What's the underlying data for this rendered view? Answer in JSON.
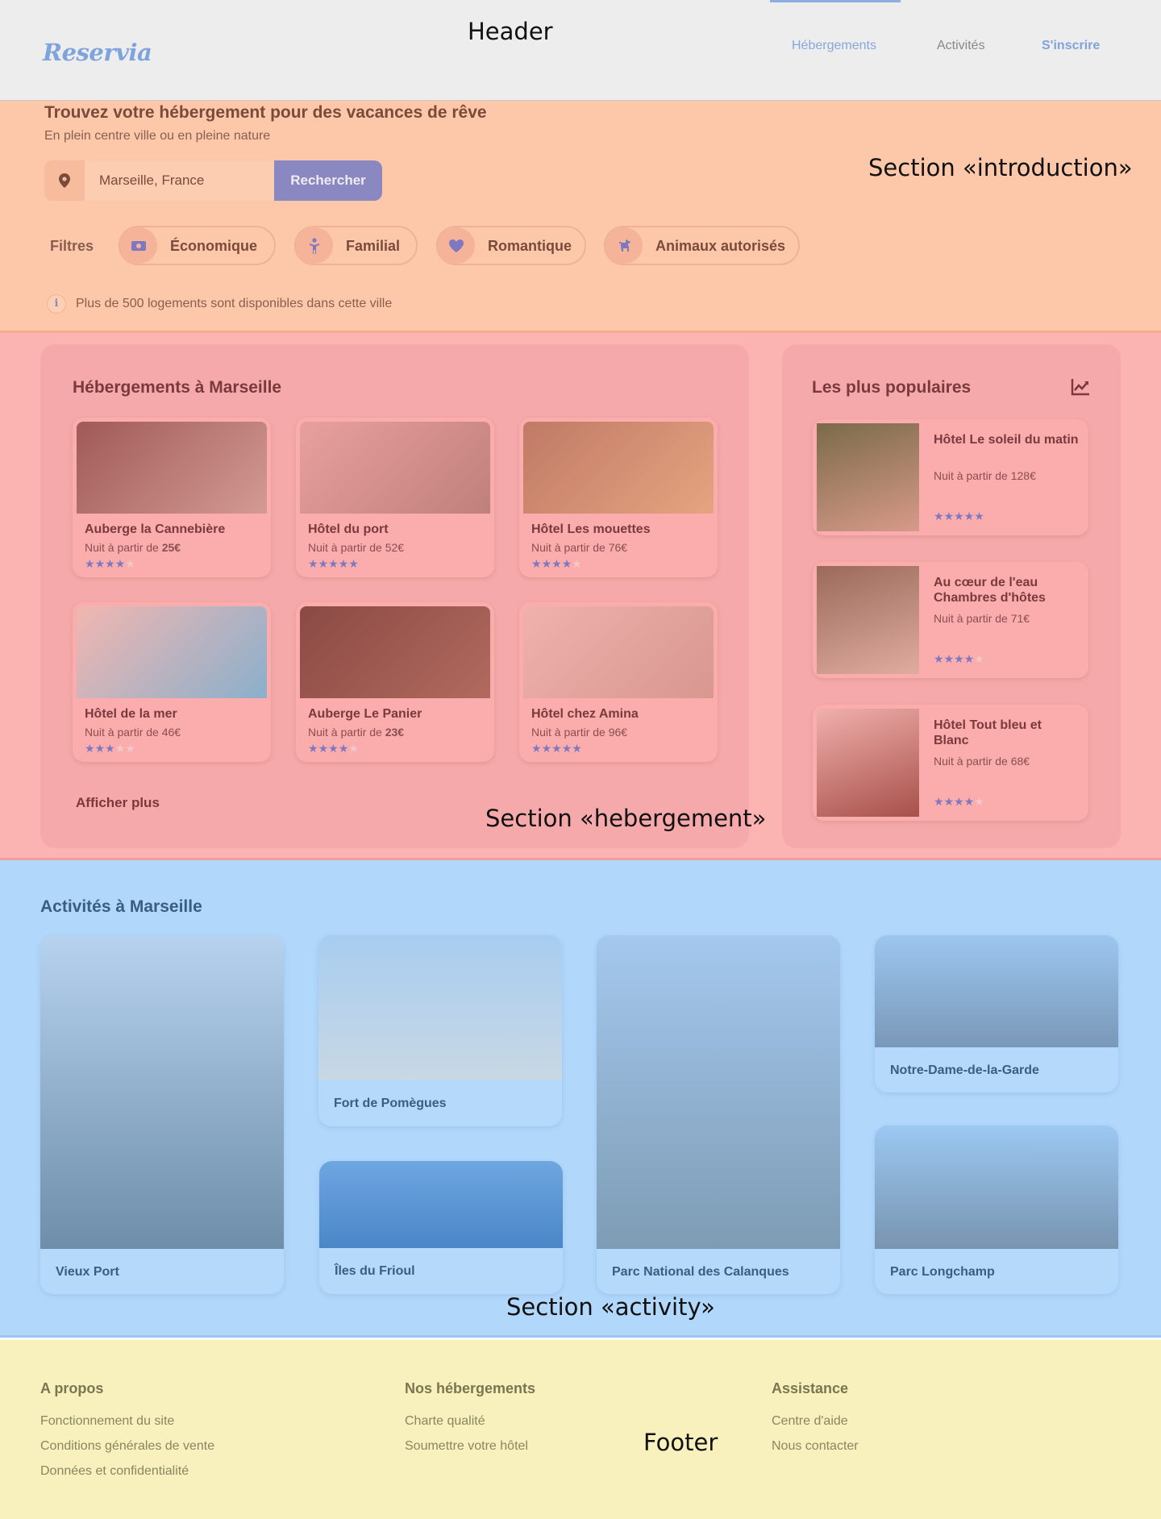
{
  "header": {
    "logo": "Reservia",
    "annotation": "Header",
    "nav": [
      {
        "label": "Hébergements",
        "active": true
      },
      {
        "label": "Activités",
        "active": false
      },
      {
        "label": "S'inscrire",
        "active": false
      }
    ]
  },
  "intro": {
    "annotation": "Section «introduction»",
    "title": "Trouvez votre hébergement pour des vacances de rêve",
    "subtitle": "En plein centre ville ou en pleine nature",
    "search": {
      "value": "Marseille, France",
      "button": "Rechercher",
      "icon": "map-pin-icon"
    },
    "filters_label": "Filtres",
    "filters": [
      {
        "label": "Économique",
        "icon": "money-icon"
      },
      {
        "label": "Familial",
        "icon": "child-icon"
      },
      {
        "label": "Romantique",
        "icon": "heart-icon"
      },
      {
        "label": "Animaux autorisés",
        "icon": "dog-icon"
      }
    ],
    "info": "Plus de 500 logements sont disponibles dans cette ville",
    "info_icon": "i"
  },
  "hebergement": {
    "annotation": "Section «hebergement»",
    "title": "Hébergements à Marseille",
    "price_prefix": "Nuit à partir de ",
    "show_more": "Afficher plus",
    "cards": [
      {
        "name": "Auberge la Cannebière",
        "price": "25€",
        "bold_price": true,
        "rating": 4,
        "colors": [
          "#a05a58",
          "#d49a94"
        ]
      },
      {
        "name": "Hôtel du port",
        "price": "52€",
        "bold_price": false,
        "rating": 5,
        "colors": [
          "#e8a09e",
          "#c0807a"
        ]
      },
      {
        "name": "Hôtel Les mouettes",
        "price": "76€",
        "bold_price": false,
        "rating": 4,
        "colors": [
          "#c07a66",
          "#e6a480"
        ]
      },
      {
        "name": "Hôtel de la mer",
        "price": "46€",
        "bold_price": false,
        "rating": 3,
        "colors": [
          "#f2b6b0",
          "#8ab0cc"
        ]
      },
      {
        "name": "Auberge Le Panier",
        "price": "23€",
        "bold_price": true,
        "rating": 4,
        "colors": [
          "#8a4a44",
          "#b26a5e"
        ]
      },
      {
        "name": "Hôtel chez Amina",
        "price": "96€",
        "bold_price": false,
        "rating": 5,
        "colors": [
          "#f0b0ac",
          "#d89890"
        ]
      }
    ]
  },
  "populaires": {
    "title": "Les plus populaires",
    "icon": "trend-chart-icon",
    "price_prefix": "Nuit à partir de ",
    "cards": [
      {
        "name": "Hôtel Le soleil du matin",
        "price": "128€",
        "rating": 5,
        "colors": [
          "#7a6a4a",
          "#d89a8a"
        ]
      },
      {
        "name": "Au cœur de l'eau Chambres d'hôtes",
        "price": "71€",
        "rating": 4,
        "colors": [
          "#9a6a5a",
          "#e0aca0"
        ]
      },
      {
        "name": "Hôtel Tout bleu et Blanc",
        "price": "68€",
        "rating": 4,
        "colors": [
          "#f0b0ac",
          "#a8504a"
        ]
      }
    ]
  },
  "activity": {
    "annotation": "Section «activity»",
    "title": "Activités à Marseille",
    "cards": [
      {
        "name": "Vieux Port",
        "colors": [
          "#b6d2ee",
          "#6e8eaa"
        ]
      },
      {
        "name": "Fort de Pomègues",
        "colors": [
          "#a8cdf0",
          "#c8d8e4"
        ]
      },
      {
        "name": "Îles du Frioul",
        "colors": [
          "#6ea6e0",
          "#4a86c8"
        ]
      },
      {
        "name": "Parc National des Calanques",
        "colors": [
          "#a4c8ee",
          "#7e9cb4"
        ]
      },
      {
        "name": "Notre-Dame-de-la-Garde",
        "colors": [
          "#9cc6f0",
          "#7a98b8"
        ]
      },
      {
        "name": "Parc Longchamp",
        "colors": [
          "#9cc8f2",
          "#7894b0"
        ]
      }
    ]
  },
  "footer": {
    "annotation": "Footer",
    "columns": [
      {
        "title": "A propos",
        "links": [
          "Fonctionnement du site",
          "Conditions générales de vente",
          "Données et confidentialité"
        ]
      },
      {
        "title": "Nos hébergements",
        "links": [
          "Charte qualité",
          "Soumettre votre hôtel"
        ]
      },
      {
        "title": "Assistance",
        "links": [
          "Centre d'aide",
          "Nous contacter"
        ]
      }
    ]
  }
}
